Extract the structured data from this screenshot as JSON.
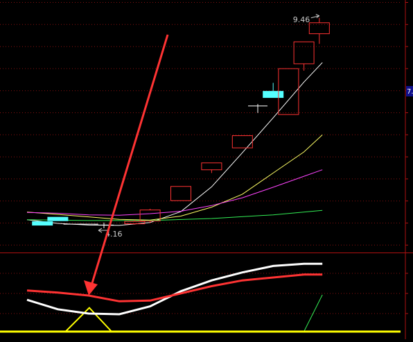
{
  "chart_data": [
    {
      "type": "candlestick",
      "panel": "price",
      "ylim": [
        3.7,
        9.9
      ],
      "grid": true,
      "annotations": {
        "high_label": "9.46",
        "low_label": "4.16",
        "right_marker": "7."
      },
      "candles": [
        {
          "i": 1,
          "open": 4.45,
          "close": 4.45,
          "high": 4.45,
          "low": 4.45,
          "color": "#55ffff",
          "filled": true
        },
        {
          "i": 2,
          "open": 4.56,
          "close": 4.48,
          "high": 4.56,
          "low": 4.48,
          "color": "#55ffff",
          "filled": true
        },
        {
          "i": 3,
          "open": 4.38,
          "close": 4.38,
          "high": 4.38,
          "low": 4.38,
          "color": "#ffffff",
          "filled": false
        },
        {
          "i": 4,
          "open": 4.38,
          "close": 4.38,
          "high": 4.38,
          "low": 4.38,
          "color": "#ffffff",
          "filled": false
        },
        {
          "i": 5,
          "open": 4.36,
          "close": 4.36,
          "high": 4.42,
          "low": 4.28,
          "color": "#ffffff",
          "filled": false
        },
        {
          "i": 7,
          "open": 4.39,
          "close": 4.45,
          "high": 4.48,
          "low": 4.37,
          "color": "#ff3333",
          "filled": false
        },
        {
          "i": 8,
          "open": 4.46,
          "close": 4.73,
          "high": 4.76,
          "low": 4.41,
          "color": "#ff3333",
          "filled": false
        },
        {
          "i": 10,
          "open": 4.96,
          "close": 5.31,
          "high": 5.31,
          "low": 4.96,
          "color": "#ff3333",
          "filled": false
        },
        {
          "i": 12,
          "open": 5.72,
          "close": 5.89,
          "high": 5.89,
          "low": 5.64,
          "color": "#ff3333",
          "filled": false
        },
        {
          "i": 14,
          "open": 6.26,
          "close": 6.56,
          "high": 6.56,
          "low": 6.26,
          "color": "#ff3333",
          "filled": false
        },
        {
          "i": 15,
          "open": 7.29,
          "close": 7.29,
          "high": 7.34,
          "low": 7.12,
          "color": "#ffffff",
          "filled": false
        },
        {
          "i": 16,
          "open": 7.66,
          "close": 7.49,
          "high": 7.86,
          "low": 7.49,
          "color": "#55ffff",
          "filled": true
        },
        {
          "i": 17,
          "open": 7.08,
          "close": 8.21,
          "high": 8.21,
          "low": 7.08,
          "color": "#ff3333",
          "filled": false
        },
        {
          "i": 18,
          "open": 8.33,
          "close": 8.87,
          "high": 8.87,
          "low": 8.16,
          "color": "#ff3333",
          "filled": false
        },
        {
          "i": 19,
          "open": 9.07,
          "close": 9.34,
          "high": 9.46,
          "low": 8.82,
          "color": "#ff3333",
          "filled": false
        }
      ],
      "moving_averages": [
        {
          "color": "#ffffff",
          "x": [
            0,
            2,
            4,
            6,
            8,
            10,
            12,
            14,
            16,
            18,
            19.2
          ],
          "y": [
            4.49,
            4.4,
            4.36,
            4.35,
            4.42,
            4.69,
            5.3,
            6.14,
            7.0,
            7.88,
            8.36
          ]
        },
        {
          "color": "#ffff66",
          "x": [
            0,
            4,
            6,
            8,
            10,
            12,
            14,
            16,
            18,
            19.2
          ],
          "y": [
            4.68,
            4.56,
            4.5,
            4.48,
            4.58,
            4.8,
            5.12,
            5.64,
            6.16,
            6.58
          ]
        },
        {
          "color": "#ff44ff",
          "x": [
            0,
            2,
            4,
            6,
            8,
            10,
            12,
            14,
            16,
            18,
            19.2
          ],
          "y": [
            4.67,
            4.65,
            4.61,
            4.6,
            4.64,
            4.7,
            4.84,
            5.03,
            5.29,
            5.56,
            5.72
          ]
        },
        {
          "color": "#33ee55",
          "x": [
            0,
            4,
            8,
            12,
            16,
            19.2
          ],
          "y": [
            4.49,
            4.47,
            4.47,
            4.52,
            4.61,
            4.72
          ]
        }
      ],
      "arrow_color": "#ff3333"
    },
    {
      "type": "line",
      "panel": "indicator",
      "ylim": [
        0,
        100
      ],
      "grid": true,
      "series": [
        {
          "color": "#ffffff",
          "x": [
            0,
            2,
            4,
            6,
            8,
            10,
            12,
            14,
            16,
            18,
            19.2
          ],
          "y": [
            44,
            31,
            25,
            24,
            35,
            56,
            71,
            82,
            91,
            94,
            94
          ]
        },
        {
          "color": "#ff3333",
          "x": [
            0,
            2,
            4,
            6,
            8,
            10,
            12,
            14,
            16,
            18,
            19.2
          ],
          "y": [
            57,
            54,
            50,
            42,
            43,
            53,
            63,
            71,
            75,
            79,
            79
          ]
        },
        {
          "color": "#33ee55",
          "x": [
            18,
            19.2
          ],
          "y": [
            0,
            51
          ]
        }
      ],
      "bands": [
        {
          "color": "#ffff00",
          "x": [
            2.5,
            4.05,
            5.5
          ],
          "y": [
            0,
            33,
            0
          ]
        }
      ],
      "baseline_color": "#ffff00"
    }
  ]
}
